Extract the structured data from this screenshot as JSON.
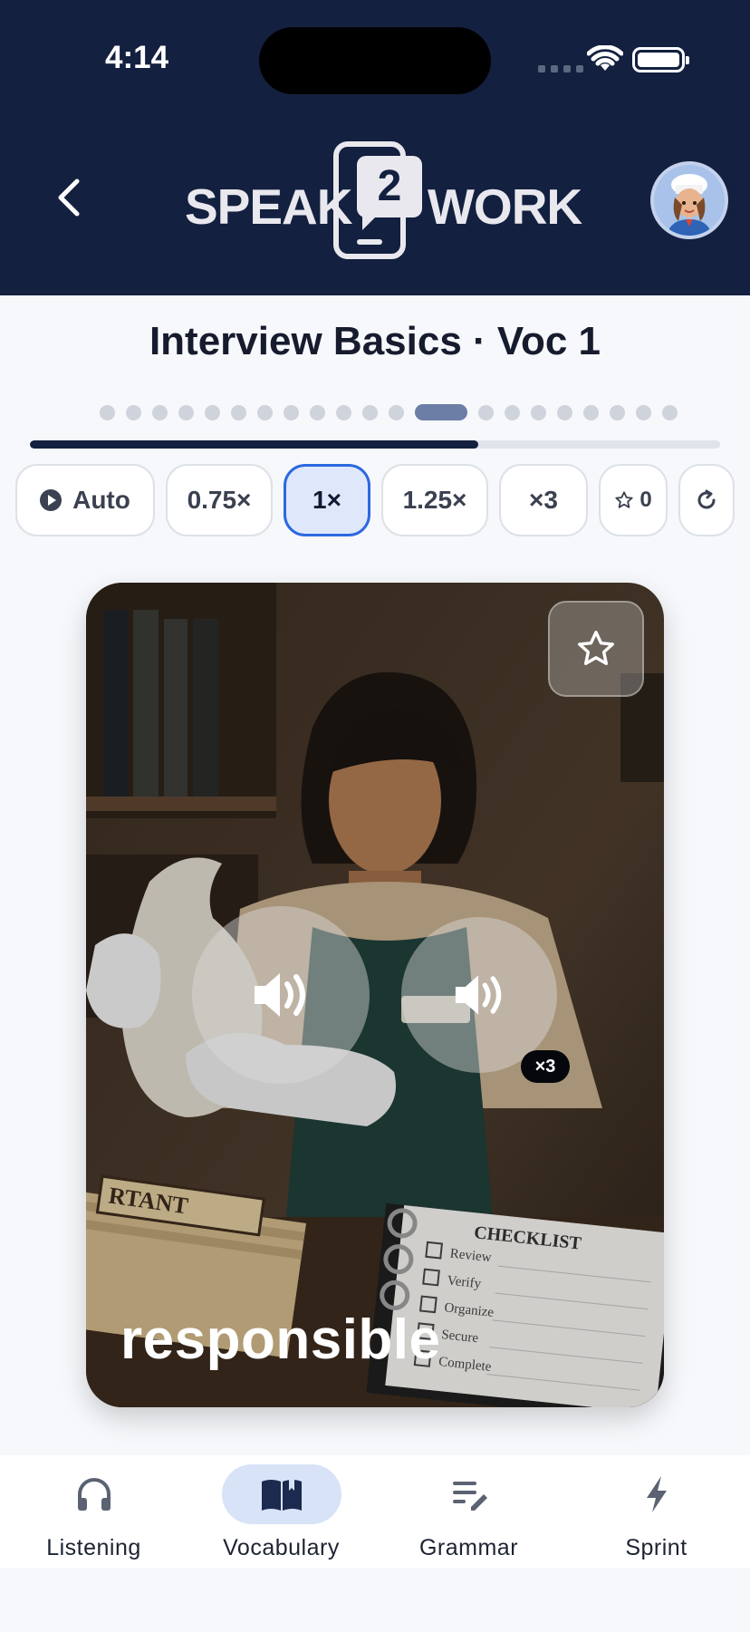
{
  "status_bar": {
    "time": "4:14"
  },
  "header": {
    "logo_left": "SPEAK",
    "logo_number": "2",
    "logo_right": "WORK"
  },
  "lesson": {
    "title": "Interview Basics · Voc 1",
    "progress_fraction": 0.65,
    "total_steps": 21,
    "current_step": 13
  },
  "controls": {
    "auto_label": "Auto",
    "speed_075": "0.75×",
    "speed_1": "1×",
    "speed_125": "1.25×",
    "repeat": "×3",
    "stars_count": "0"
  },
  "card": {
    "word": "responsible",
    "repeat_badge": "×3",
    "folder_text": "RTANT",
    "checklist_title": "CHECKLIST",
    "checklist_items": [
      "Review",
      "Verify",
      "Organize",
      "Secure",
      "Complete"
    ]
  },
  "tabs": [
    {
      "label": "Listening",
      "icon": "headphones-icon"
    },
    {
      "label": "Vocabulary",
      "icon": "book-icon"
    },
    {
      "label": "Grammar",
      "icon": "edit-list-icon"
    },
    {
      "label": "Sprint",
      "icon": "bolt-icon"
    }
  ],
  "colors": {
    "header_bg": "#13203f",
    "accent": "#2d68e0",
    "active_tab_bg": "#d8e3f7"
  }
}
